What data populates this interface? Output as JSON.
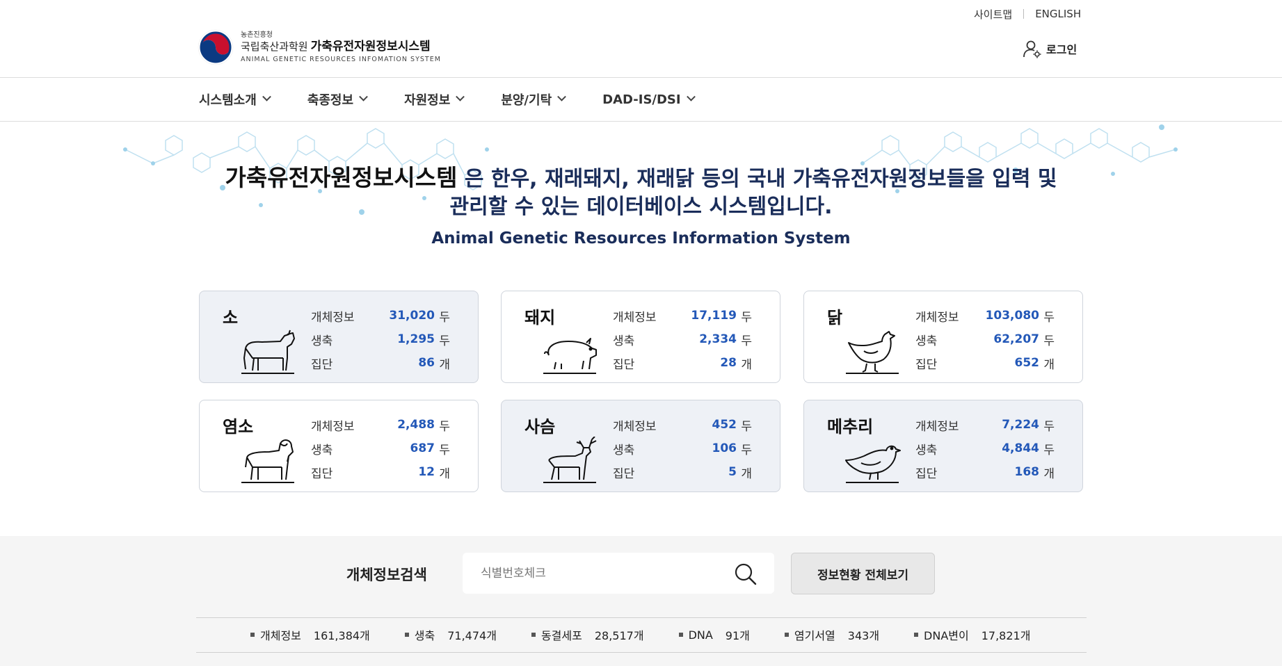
{
  "util": {
    "sitemap": "사이트맵",
    "english": "ENGLISH"
  },
  "logo": {
    "agency": "농촌진흥청",
    "institute": "국립축산과학원",
    "system": "가축유전자원정보시스템",
    "english": "ANIMAL GENETIC RESOURCES INFOMATION SYSTEM"
  },
  "login": {
    "label": "로그인"
  },
  "nav": [
    {
      "label": "시스템소개"
    },
    {
      "label": "축종정보"
    },
    {
      "label": "자원정보"
    },
    {
      "label": "분양/기탁"
    },
    {
      "label": "DAD-IS/DSI"
    }
  ],
  "hero": {
    "system_name": "가축유전자원정보시스템",
    "line1_rest": " 은 한우, 재래돼지, 재래닭 등의 국내 가축유전자원정보들을 입력 및",
    "line2": "관리할 수 있는 데이터베이스 시스템입니다.",
    "english": "Animal Genetic Resources Information System"
  },
  "cards": [
    {
      "title": "소",
      "icon": "cow-icon",
      "rows": [
        {
          "label": "개체정보",
          "value": "31,020",
          "unit": "두"
        },
        {
          "label": "생축",
          "value": "1,295",
          "unit": "두"
        },
        {
          "label": "집단",
          "value": "86",
          "unit": "개"
        }
      ]
    },
    {
      "title": "돼지",
      "icon": "pig-icon",
      "rows": [
        {
          "label": "개체정보",
          "value": "17,119",
          "unit": "두"
        },
        {
          "label": "생축",
          "value": "2,334",
          "unit": "두"
        },
        {
          "label": "집단",
          "value": "28",
          "unit": "개"
        }
      ]
    },
    {
      "title": "닭",
      "icon": "chicken-icon",
      "rows": [
        {
          "label": "개체정보",
          "value": "103,080",
          "unit": "두"
        },
        {
          "label": "생축",
          "value": "62,207",
          "unit": "두"
        },
        {
          "label": "집단",
          "value": "652",
          "unit": "개"
        }
      ]
    },
    {
      "title": "염소",
      "icon": "goat-icon",
      "rows": [
        {
          "label": "개체정보",
          "value": "2,488",
          "unit": "두"
        },
        {
          "label": "생축",
          "value": "687",
          "unit": "두"
        },
        {
          "label": "집단",
          "value": "12",
          "unit": "개"
        }
      ]
    },
    {
      "title": "사슴",
      "icon": "deer-icon",
      "rows": [
        {
          "label": "개체정보",
          "value": "452",
          "unit": "두"
        },
        {
          "label": "생축",
          "value": "106",
          "unit": "두"
        },
        {
          "label": "집단",
          "value": "5",
          "unit": "개"
        }
      ]
    },
    {
      "title": "메추리",
      "icon": "quail-icon",
      "rows": [
        {
          "label": "개체정보",
          "value": "7,224",
          "unit": "두"
        },
        {
          "label": "생축",
          "value": "4,844",
          "unit": "두"
        },
        {
          "label": "집단",
          "value": "168",
          "unit": "개"
        }
      ]
    }
  ],
  "search": {
    "title": "개체정보검색",
    "placeholder": "식별번호체크",
    "view_all": "정보현황 전체보기"
  },
  "summary": [
    {
      "label": "개체정보",
      "value": "161,384개"
    },
    {
      "label": "생축",
      "value": "71,474개"
    },
    {
      "label": "동결세포",
      "value": "28,517개"
    },
    {
      "label": "DNA",
      "value": "91개"
    },
    {
      "label": "염기서열",
      "value": "343개"
    },
    {
      "label": "DNA변이",
      "value": "17,821개"
    }
  ],
  "colors": {
    "accent": "#2358b8",
    "hero_text": "#1a2d5a",
    "card_shade": "#eef1f6",
    "band": "#f5f5f5"
  }
}
